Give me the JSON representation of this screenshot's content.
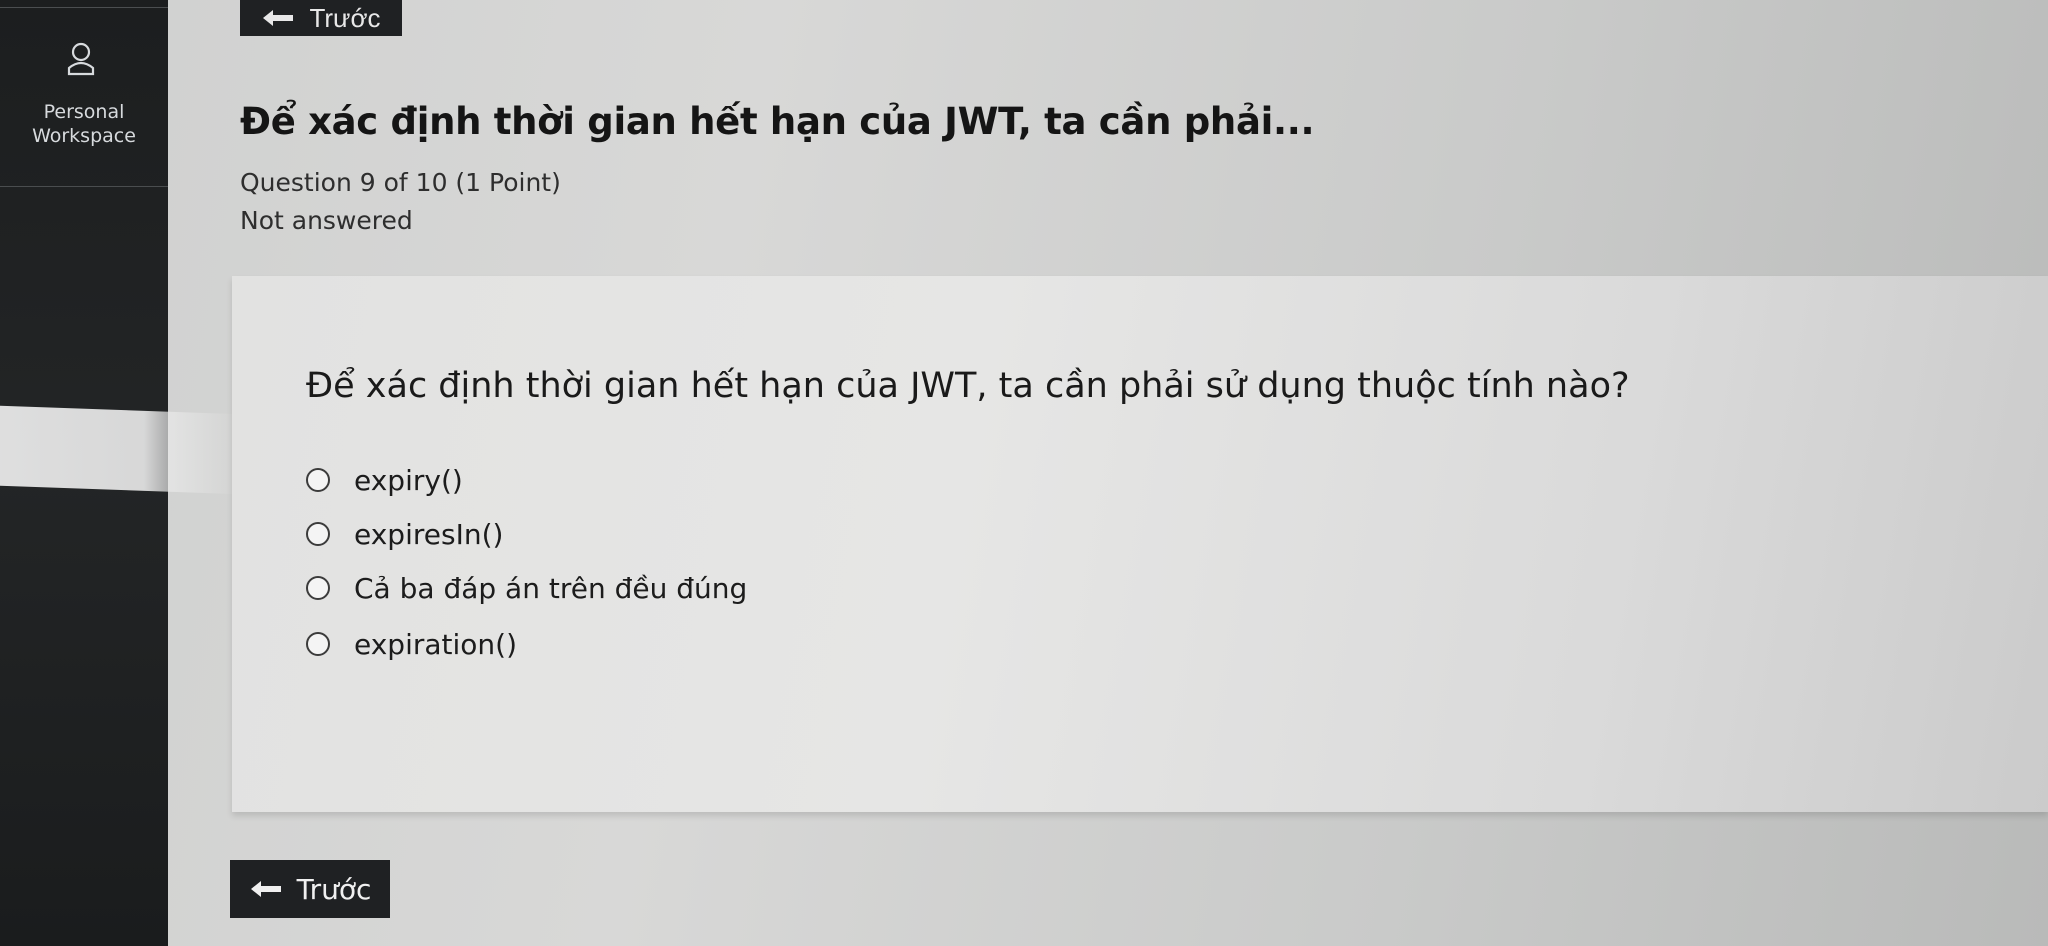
{
  "sidebar": {
    "workspace_line1": "Personal",
    "workspace_line2": "Workspace",
    "workspace_icon": "user-icon"
  },
  "nav": {
    "back_top_label": "Trước",
    "back_bottom_label": "Trước",
    "back_icon": "arrow-left-icon"
  },
  "header": {
    "title": "Để xác định thời gian hết hạn của JWT, ta cần phải...",
    "question_meta": "Question 9 of 10 (1 Point)",
    "status": "Not answered"
  },
  "question": {
    "text": "Để xác định thời gian hết hạn của JWT, ta cần phải sử dụng thuộc tính nào?",
    "options": [
      "expiry()",
      "expiresIn()",
      "Cả ba đáp án trên đều đúng",
      "expiration()"
    ]
  }
}
